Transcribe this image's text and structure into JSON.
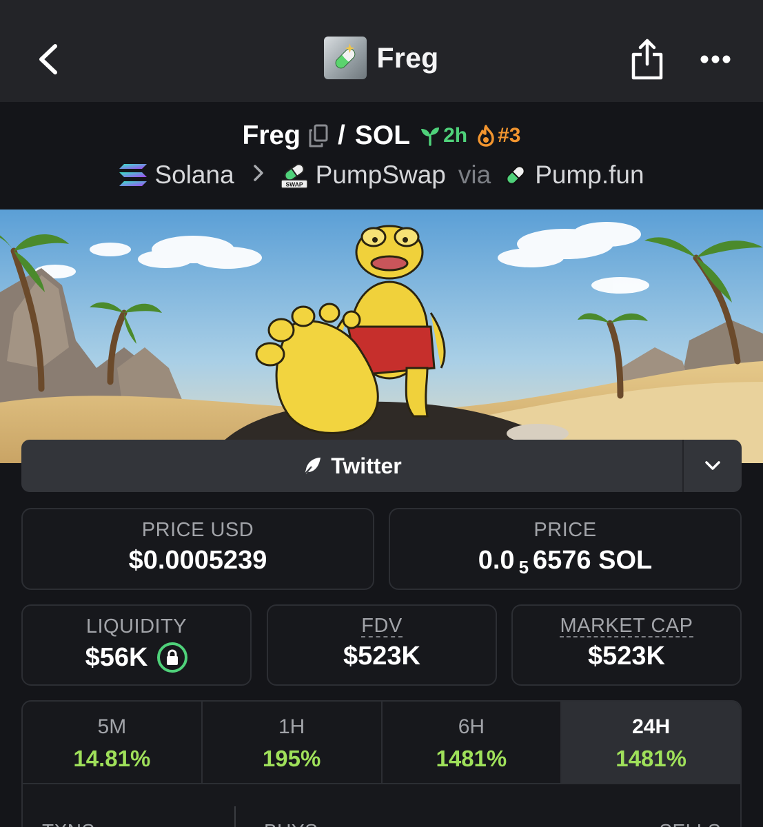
{
  "topbar": {
    "title": "Freg",
    "back_icon": "chevron-left-icon",
    "share_icon": "share-icon",
    "more_icon": "more-horizontal-icon"
  },
  "pair": {
    "base": "Freg",
    "separator": "/",
    "quote": "SOL",
    "age": "2h",
    "rank": "#3",
    "age_color": "#4fd17a",
    "rank_color": "#f2952f"
  },
  "route": {
    "chain": "Solana",
    "dex": "PumpSwap",
    "via_text": "via",
    "launchpad": "Pump.fun",
    "dex_badge": "SWAP"
  },
  "social": {
    "twitter_label": "Twitter"
  },
  "stats": {
    "price_usd": {
      "label": "PRICE USD",
      "value": "$0.0005239"
    },
    "price": {
      "label": "PRICE",
      "value_prefix": "0.0",
      "value_sub": "5",
      "value_suffix": "6576 SOL"
    },
    "liquidity": {
      "label": "LIQUIDITY",
      "value": "$56K"
    },
    "fdv": {
      "label": "FDV",
      "value": "$523K"
    },
    "market_cap": {
      "label": "MARKET CAP",
      "value": "$523K"
    }
  },
  "timeframes": [
    {
      "label": "5M",
      "value": "14.81%"
    },
    {
      "label": "1H",
      "value": "195%"
    },
    {
      "label": "6H",
      "value": "1481%"
    },
    {
      "label": "24H",
      "value": "1481%",
      "active": true
    }
  ],
  "txns": {
    "txns_label": "TXNS",
    "buys_label": "BUYS",
    "sells_label": "SELLS"
  },
  "colors": {
    "positive": "#9fe05a",
    "background": "#141519",
    "topbar": "#232428"
  }
}
